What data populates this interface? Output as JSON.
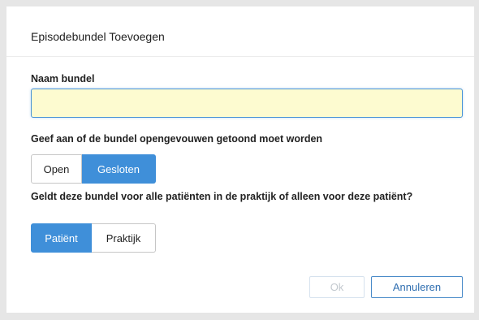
{
  "dialog": {
    "title": "Episodebundel Toevoegen",
    "name_label": "Naam bundel",
    "name_value": "",
    "name_placeholder": "",
    "open_question": "Geef aan of de bundel opengevouwen getoond moet worden",
    "open_options": {
      "open": "Open",
      "closed": "Gesloten",
      "selected": "Gesloten"
    },
    "scope_question": "Geldt deze bundel voor alle patiënten in de praktijk of alleen voor deze patiënt?",
    "scope_options": {
      "patient": "Patiënt",
      "practice": "Praktijk",
      "selected": "Patiënt"
    },
    "ok_label": "Ok",
    "cancel_label": "Annuleren"
  },
  "colors": {
    "accent": "#3f8fd9",
    "input_background": "#fdfbd0",
    "input_focus_border": "#4a94d6",
    "disabled_text": "#c2c8ce",
    "backdrop": "#e6e6e6"
  }
}
